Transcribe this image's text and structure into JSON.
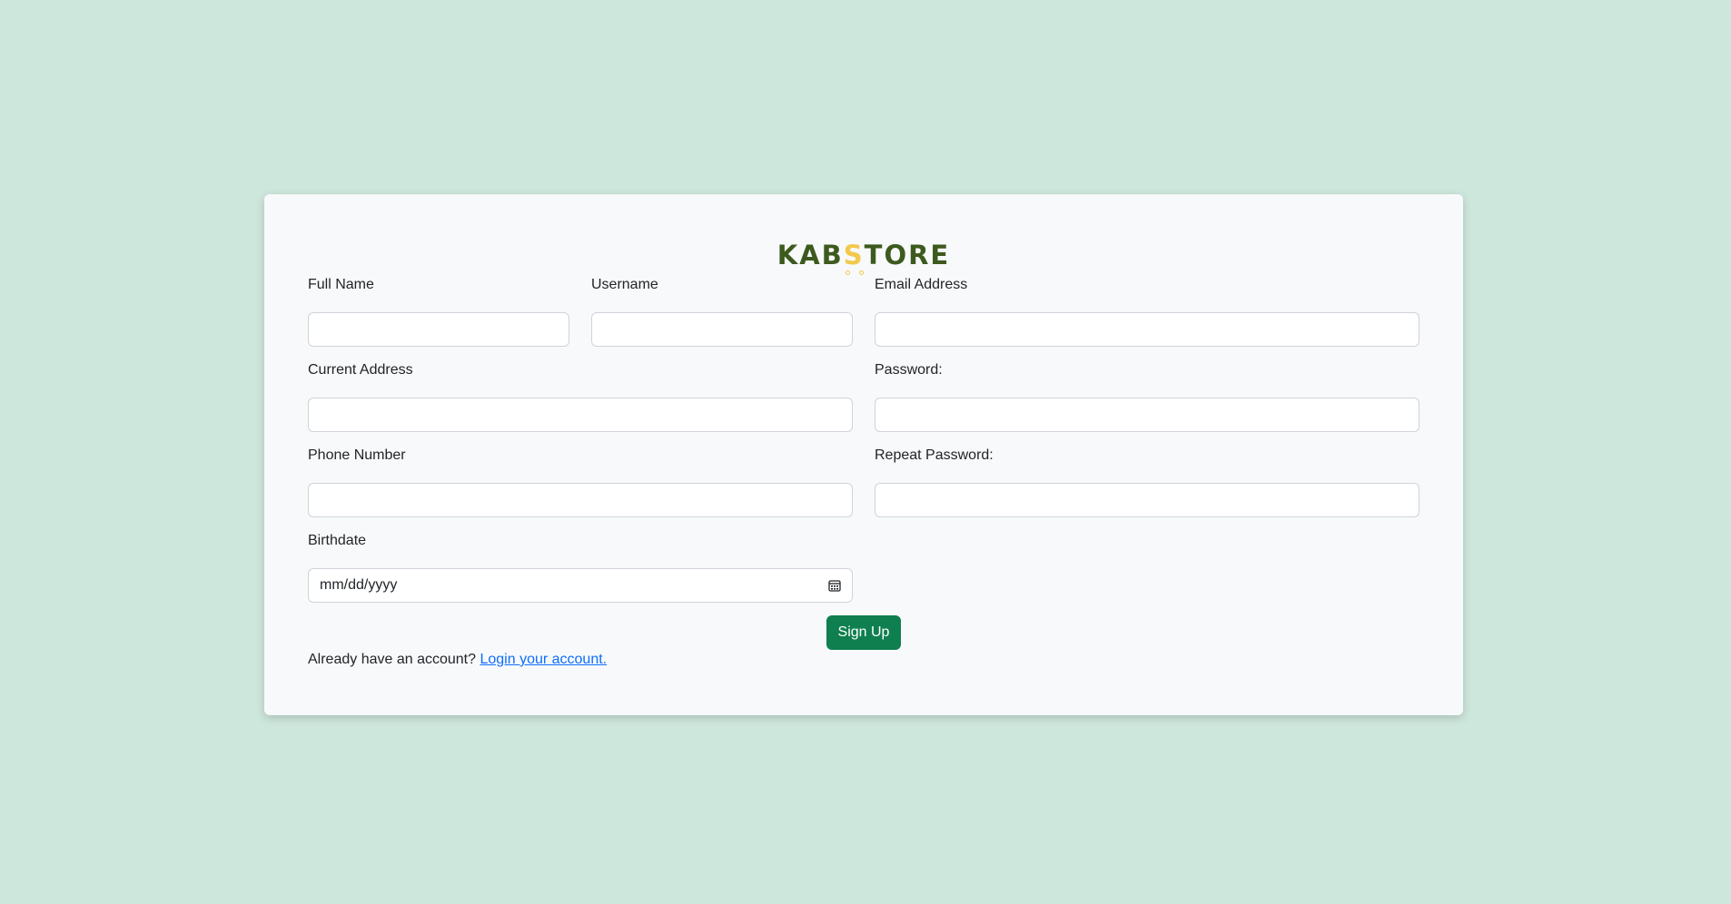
{
  "brand": {
    "logo_prefix": "KAB",
    "logo_s": "S",
    "logo_suffix": "TORE"
  },
  "form": {
    "full_name_label": "Full Name",
    "username_label": "Username",
    "email_label": "Email Address",
    "current_address_label": "Current Address",
    "password_label": "Password:",
    "phone_label": "Phone Number",
    "repeat_password_label": "Repeat Password:",
    "birthdate_label": "Birthdate",
    "birthdate_placeholder": "mm/dd/yyyy",
    "submit_label": "Sign Up"
  },
  "footer": {
    "prompt_text": "Already have an account?",
    "login_link_text": "Login your account."
  },
  "icons": {
    "birthdate_icon": "calendar-icon"
  },
  "colors": {
    "page_background": "#cee7dd",
    "card_background": "#f8f9fa",
    "primary_button": "#0f7f4f",
    "logo_green": "#3d5a1e",
    "logo_accent": "#f2c94c",
    "link": "#0d6efd"
  }
}
